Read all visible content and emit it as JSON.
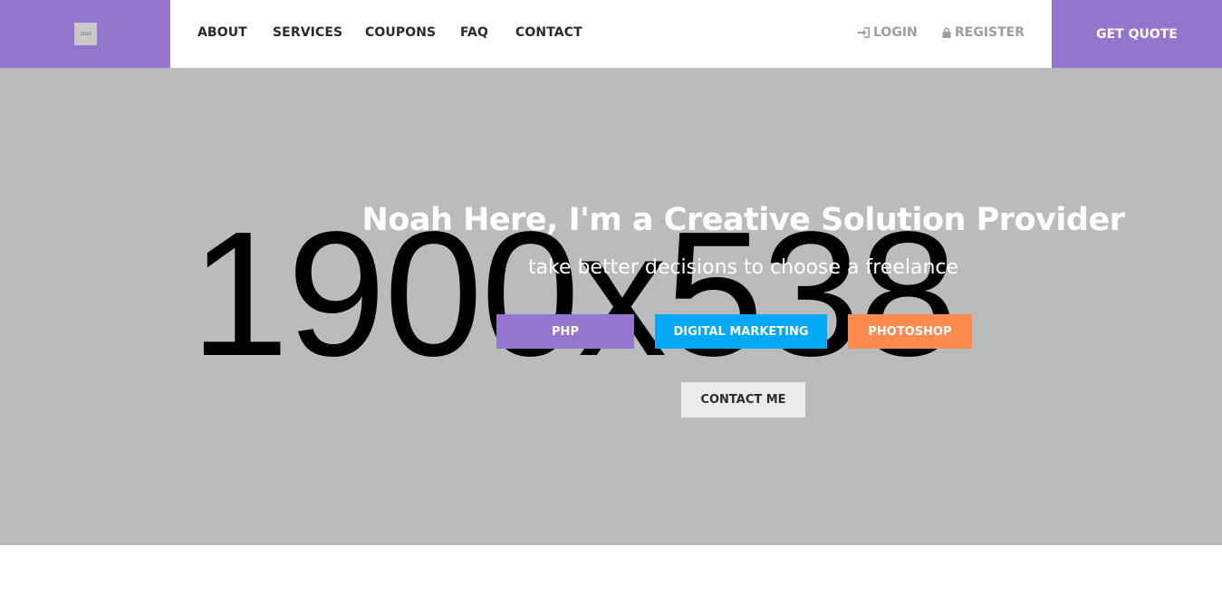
{
  "header": {
    "logo_text": "25x25",
    "nav": [
      "ABOUT",
      "SERVICES",
      "COUPONS",
      "FAQ",
      "CONTACT"
    ],
    "login_label": "LOGIN",
    "register_label": "REGISTER",
    "quote_label": "GET QUOTE"
  },
  "hero": {
    "placeholder_text": "1900x538",
    "title": "Noah Here, I'm a Creative Solution Provider",
    "subtitle": "take better decisions to choose a freelance",
    "tags": [
      "PHP",
      "DIGITAL MARKETING",
      "PHOTOSHOP"
    ],
    "contact_label": "CONTACT ME"
  },
  "colors": {
    "brand_purple": "#9575cd",
    "sky_blue": "#03a9f4",
    "orange": "#ff8a50",
    "hero_bg": "#bbbbbb"
  }
}
